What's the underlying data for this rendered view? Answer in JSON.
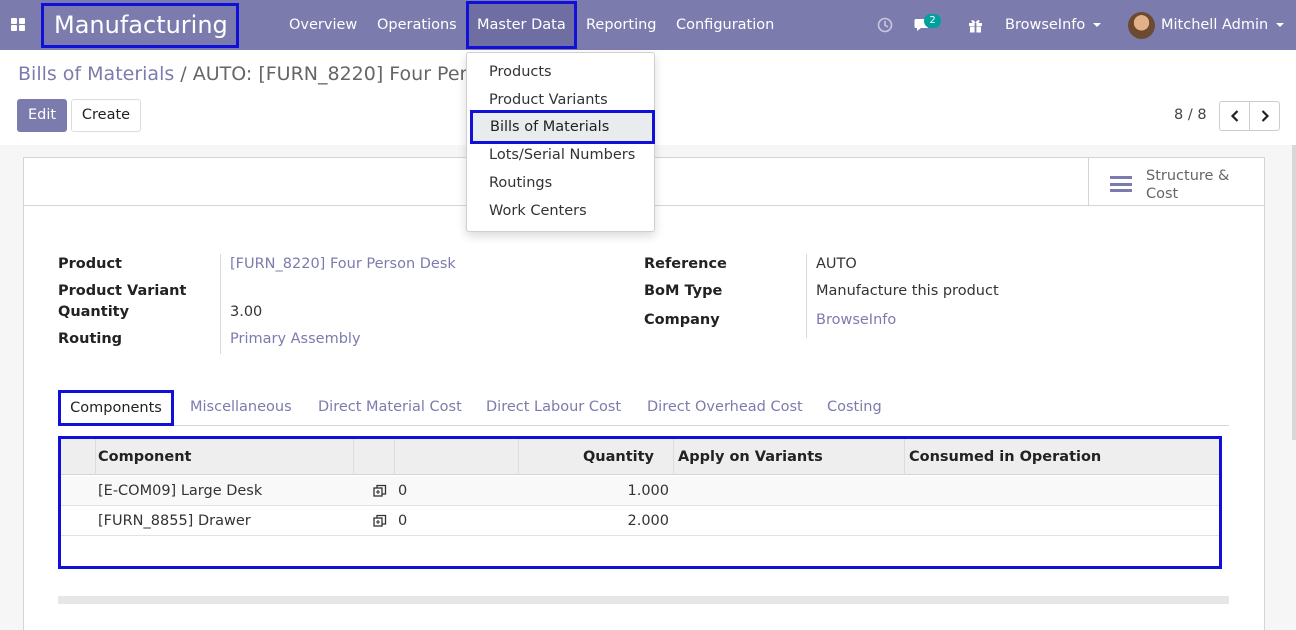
{
  "navbar": {
    "app_title": "Manufacturing",
    "menu": [
      "Overview",
      "Operations",
      "Master Data",
      "Reporting",
      "Configuration"
    ],
    "active_menu": "Master Data",
    "message_count": "2",
    "company": "BrowseInfo",
    "user": "Mitchell Admin"
  },
  "dropdown": {
    "items": [
      "Products",
      "Product Variants",
      "Bills of Materials",
      "Lots/Serial Numbers",
      "Routings",
      "Work Centers"
    ],
    "highlighted": "Bills of Materials"
  },
  "control_panel": {
    "breadcrumb_parent": "Bills of Materials",
    "breadcrumb_sep": "/",
    "breadcrumb_current": "AUTO: [FURN_8220] Four Person Desk",
    "edit_label": "Edit",
    "create_label": "Create",
    "pager": "8 / 8"
  },
  "form": {
    "smart_button": "Structure & Cost",
    "left": {
      "product_label": "Product",
      "product_value": "[FURN_8220] Four Person Desk",
      "variant_label": "Product Variant",
      "quantity_label": "Quantity",
      "quantity_value": "3.00",
      "routing_label": "Routing",
      "routing_value": "Primary Assembly"
    },
    "right": {
      "reference_label": "Reference",
      "reference_value": "AUTO",
      "bom_type_label": "BoM Type",
      "bom_type_value": "Manufacture this product",
      "company_label": "Company",
      "company_value": "BrowseInfo"
    }
  },
  "tabs": [
    "Components",
    "Miscellaneous",
    "Direct Material Cost",
    "Direct Labour Cost",
    "Direct Overhead Cost",
    "Costing"
  ],
  "active_tab": "Components",
  "components_table": {
    "headers": [
      "Component",
      "Quantity",
      "Apply on Variants",
      "Consumed in Operation"
    ],
    "rows": [
      {
        "component": "[E-COM09] Large Desk",
        "count": "0",
        "quantity": "1.000"
      },
      {
        "component": "[FURN_8855] Drawer",
        "count": "0",
        "quantity": "2.000"
      }
    ]
  },
  "colors": {
    "brand": "#7c7bad",
    "highlight_box": "#1010d8",
    "badge": "#00a09d"
  },
  "icons": [
    "apps-grid-icon",
    "clock-icon",
    "chat-icon",
    "gift-icon",
    "chevron-left-icon",
    "chevron-right-icon",
    "list-bars-icon",
    "duplicate-icon"
  ]
}
